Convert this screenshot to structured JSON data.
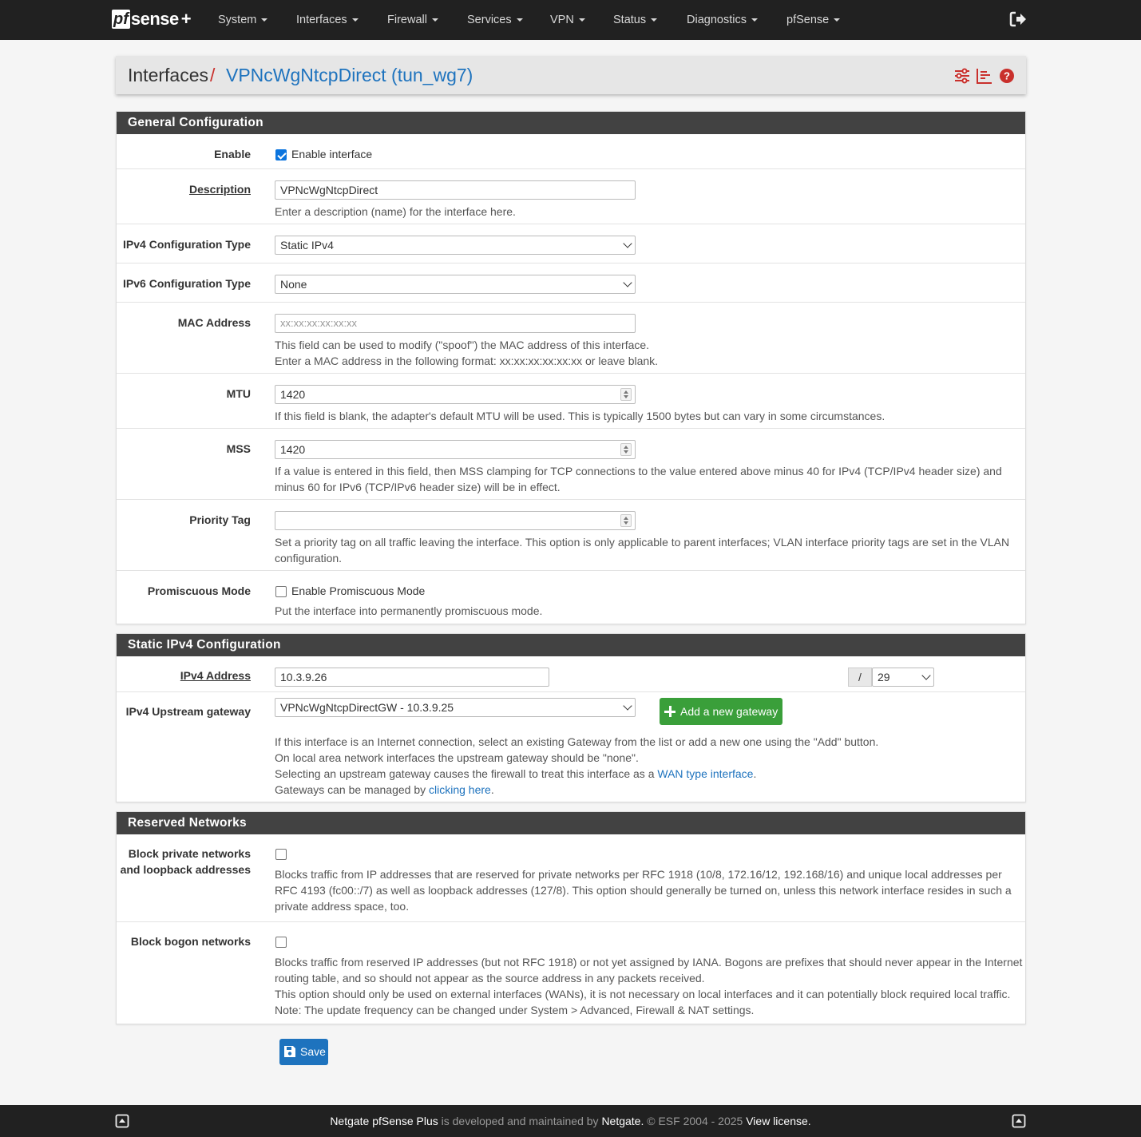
{
  "nav": {
    "logo": {
      "pf": "pf",
      "sense": "sense",
      "plus": "+"
    },
    "items": [
      {
        "label": "System"
      },
      {
        "label": "Interfaces"
      },
      {
        "label": "Firewall"
      },
      {
        "label": "Services"
      },
      {
        "label": "VPN"
      },
      {
        "label": "Status"
      },
      {
        "label": "Diagnostics"
      },
      {
        "label": "pfSense"
      }
    ],
    "logout_icon": "sign-out-icon"
  },
  "breadcrumb": {
    "parent": "Interfaces",
    "separator": "/",
    "current": "VPNcWgNtcpDirect (tun_wg7)",
    "icons": [
      "sliders-icon",
      "bar-chart-icon",
      "question-circle-icon"
    ]
  },
  "general": {
    "heading": "General Configuration",
    "enable": {
      "label": "Enable",
      "checkbox_label": "Enable interface",
      "checked": true
    },
    "description": {
      "label": "Description",
      "value": "VPNcWgNtcpDirect",
      "help": "Enter a description (name) for the interface here."
    },
    "ipv4_type": {
      "label": "IPv4 Configuration Type",
      "value": "Static IPv4"
    },
    "ipv6_type": {
      "label": "IPv6 Configuration Type",
      "value": "None"
    },
    "mac": {
      "label": "MAC Address",
      "placeholder": "xx:xx:xx:xx:xx:xx",
      "help1": "This field can be used to modify (\"spoof\") the MAC address of this interface.",
      "help2": "Enter a MAC address in the following format: xx:xx:xx:xx:xx:xx or leave blank."
    },
    "mtu": {
      "label": "MTU",
      "value": "1420",
      "help": "If this field is blank, the adapter's default MTU will be used. This is typically 1500 bytes but can vary in some circumstances."
    },
    "mss": {
      "label": "MSS",
      "value": "1420",
      "help1": "If a value is entered in this field, then MSS clamping for TCP connections to the value entered above minus 40 for IPv4 (TCP/IPv4 header size) and",
      "help2": "minus 60 for IPv6 (TCP/IPv6 header size) will be in effect."
    },
    "priority": {
      "label": "Priority Tag",
      "value": "",
      "help1": "Set a priority tag on all traffic leaving the interface. This option is only applicable to parent interfaces; VLAN interface priority tags are set in the VLAN",
      "help2": "configuration."
    },
    "promisc": {
      "label": "Promiscuous Mode",
      "checkbox_label": "Enable Promiscuous Mode",
      "checked": false,
      "help": "Put the interface into permanently promiscuous mode."
    }
  },
  "static_ipv4": {
    "heading": "Static IPv4 Configuration",
    "address": {
      "label": "IPv4 Address",
      "value": "10.3.9.26",
      "slash": "/",
      "cidr": "29"
    },
    "gateway": {
      "label": "IPv4 Upstream gateway",
      "value": "VPNcWgNtcpDirectGW - 10.3.9.25",
      "add_button": "Add a new gateway",
      "help1": "If this interface is an Internet connection, select an existing Gateway from the list or add a new one using the \"Add\" button.",
      "help2": "On local area network interfaces the upstream gateway should be \"none\".",
      "help3_pre": "Selecting an upstream gateway causes the firewall to treat this interface as a ",
      "help3_link": "WAN type interface",
      "help3_post": ".",
      "help4_pre": "Gateways can be managed by ",
      "help4_link": "clicking here",
      "help4_post": "."
    }
  },
  "reserved": {
    "heading": "Reserved Networks",
    "private": {
      "label1": "Block private networks",
      "label2": "and loopback addresses",
      "checked": false,
      "help1": "Blocks traffic from IP addresses that are reserved for private networks per RFC 1918 (10/8, 172.16/12, 192.168/16) and unique local addresses per",
      "help2": "RFC 4193 (fc00::/7) as well as loopback addresses (127/8). This option should generally be turned on, unless this network interface resides in such a",
      "help3": "private address space, too."
    },
    "bogon": {
      "label": "Block bogon networks",
      "checked": false,
      "help1": "Blocks traffic from reserved IP addresses (but not RFC 1918) or not yet assigned by IANA. Bogons are prefixes that should never appear in the Internet",
      "help2": "routing table, and so should not appear as the source address in any packets received.",
      "help3": "This option should only be used on external interfaces (WANs), it is not necessary on local interfaces and it can potentially block required local traffic.",
      "help4": "Note: The update frequency can be changed under System > Advanced, Firewall & NAT settings."
    }
  },
  "save_label": "Save",
  "footer": {
    "product": "Netgate pfSense Plus",
    "middle": " is developed and maintained by ",
    "company": "Netgate.",
    "copyright": " © ESF 2004 - 2025 ",
    "license": "View license."
  }
}
